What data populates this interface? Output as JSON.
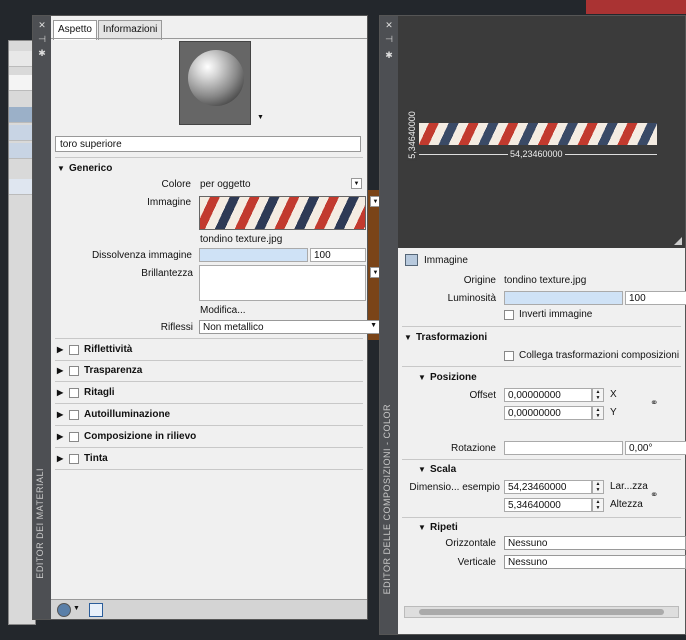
{
  "material_editor": {
    "title": "EDITOR DEI MATERIALI",
    "tabs": [
      "Aspetto",
      "Informazioni"
    ],
    "material_name": "toro superiore",
    "generic": {
      "header": "Generico",
      "colore_label": "Colore",
      "colore_value": "per oggetto",
      "immagine_label": "Immagine",
      "image_filename": "tondino texture.jpg",
      "dissolvenza_label": "Dissolvenza immagine",
      "dissolvenza_value": "100",
      "brillantezza_label": "Brillantezza",
      "modifica_link": "Modifica...",
      "riflessi_label": "Riflessi",
      "riflessi_value": "Non metallico"
    },
    "sections": [
      "Riflettività",
      "Trasparenza",
      "Ritagli",
      "Autoilluminazione",
      "Composizione in rilievo",
      "Tinta"
    ]
  },
  "composition_editor": {
    "title": "EDITOR DELLE COMPOSIZIONI - COLOR",
    "preview": {
      "width_dim": "54,23460000",
      "height_dim": "5,34640000"
    },
    "image_section": {
      "header": "Immagine",
      "origine_label": "Origine",
      "origine_value": "tondino texture.jpg",
      "luminosita_label": "Luminosità",
      "luminosita_value": "100",
      "inverti_label": "Inverti immagine"
    },
    "transform": {
      "header": "Trasformazioni",
      "collega_label": "Collega trasformazioni composizioni",
      "posizione_header": "Posizione",
      "offset_label": "Offset",
      "offset_x": "0,00000000",
      "offset_y": "0,00000000",
      "x_axis": "X",
      "y_axis": "Y",
      "rotazione_label": "Rotazione",
      "rotazione_value": "0,00°",
      "scala_header": "Scala",
      "dimensione_label": "Dimensio... esempio",
      "width_value": "54,23460000",
      "height_value": "5,34640000",
      "width_label": "Lar...zza",
      "height_label": "Altezza",
      "ripeti_header": "Ripeti",
      "orizzontale_label": "Orizzontale",
      "orizzontale_value": "Nessuno",
      "verticale_label": "Verticale",
      "verticale_value": "Nessuno"
    }
  }
}
